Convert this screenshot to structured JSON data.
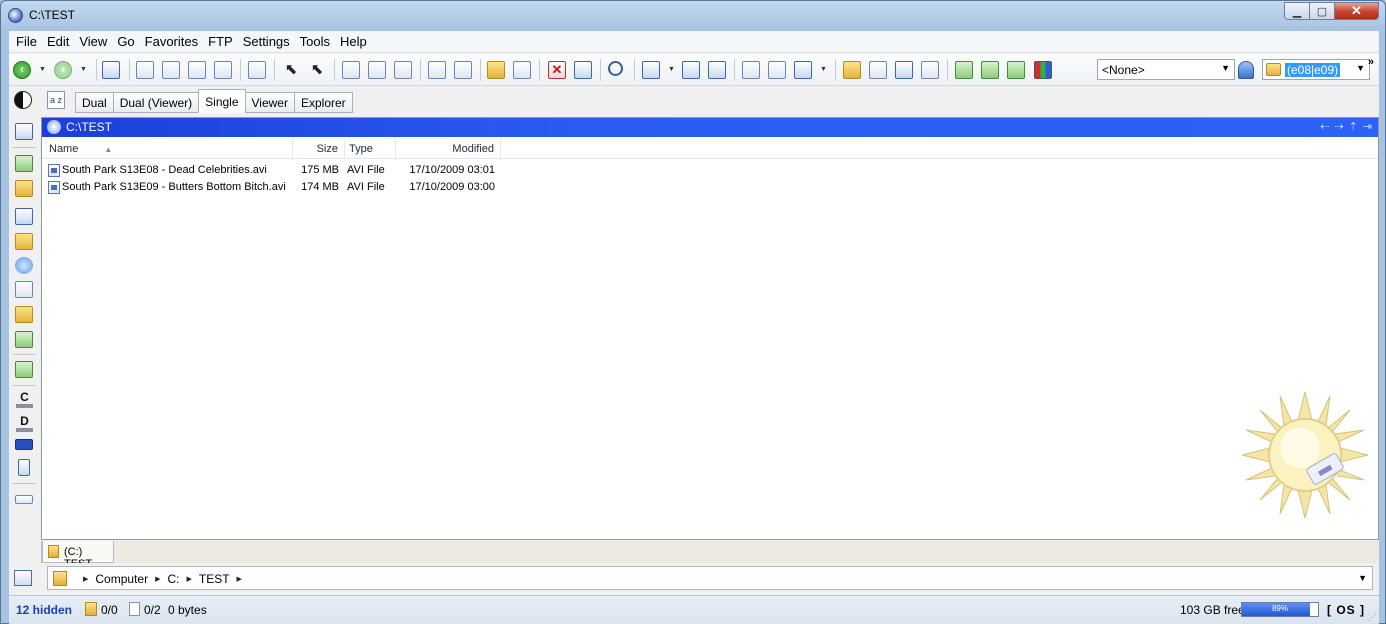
{
  "window": {
    "title": "C:\\TEST"
  },
  "menu": [
    "File",
    "Edit",
    "View",
    "Go",
    "Favorites",
    "FTP",
    "Settings",
    "Tools",
    "Help"
  ],
  "toolbar": {
    "filter_combo": "<None>",
    "search_combo": "(e08|e09)",
    "more": "»"
  },
  "layouts": {
    "tabs": [
      "Dual",
      "Dual (Viewer)",
      "Single",
      "Viewer",
      "Explorer"
    ],
    "active": "Single"
  },
  "lister": {
    "path": "C:\\TEST",
    "columns": {
      "name": "Name",
      "size": "Size",
      "type": "Type",
      "modified": "Modified"
    },
    "files": [
      {
        "name": "South Park S13E08 - Dead Celebrities.avi",
        "size": "175 MB",
        "type": "AVI File",
        "modified": "17/10/2009 03:01"
      },
      {
        "name": "South Park S13E09 - Butters Bottom Bitch.avi",
        "size": "174 MB",
        "type": "AVI File",
        "modified": "17/10/2009 03:00"
      }
    ]
  },
  "folder_tab": {
    "label": "(C:) TEST"
  },
  "breadcrumb": [
    "Computer",
    "C:",
    "TEST"
  ],
  "status": {
    "hidden": "12 hidden",
    "folders": "0/0",
    "files": "0/2",
    "bytes": "0 bytes",
    "free": "103 GB free",
    "free_percent_label": "89%",
    "free_fraction": 0.89,
    "os": "[ OS ]"
  },
  "sidebar_drives": [
    "C",
    "D"
  ],
  "colors": {
    "pathbar": "#2a5cf2",
    "hidden_text": "#1a3fb8"
  }
}
